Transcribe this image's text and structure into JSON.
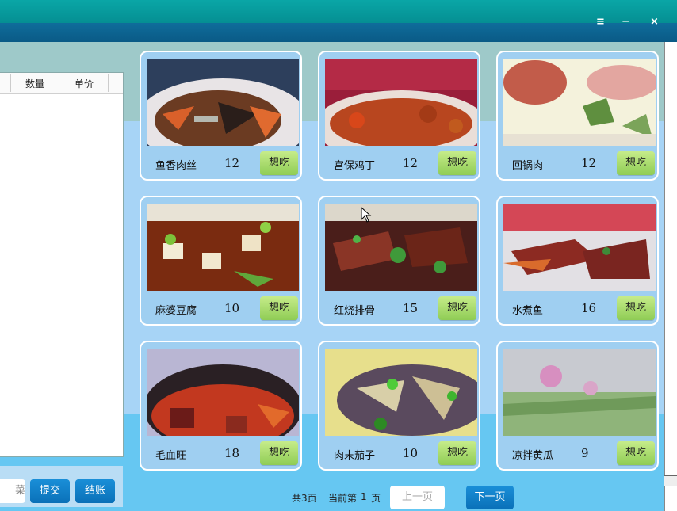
{
  "window": {
    "controls": {
      "menu": "≡",
      "minimize": "−",
      "close": "×"
    }
  },
  "order": {
    "columns": [
      "数量",
      "单价"
    ],
    "partial_button": "菜",
    "submit_label": "提交",
    "checkout_label": "结账"
  },
  "dishes": [
    {
      "name": "鱼香肉丝",
      "price": "12",
      "button": "想吃"
    },
    {
      "name": "宫保鸡丁",
      "price": "12",
      "button": "想吃"
    },
    {
      "name": "回锅肉",
      "price": "12",
      "button": "想吃"
    },
    {
      "name": "麻婆豆腐",
      "price": "10",
      "button": "想吃"
    },
    {
      "name": "红烧排骨",
      "price": "15",
      "button": "想吃"
    },
    {
      "name": "水煮鱼",
      "price": "16",
      "button": "想吃"
    },
    {
      "name": "毛血旺",
      "price": "18",
      "button": "想吃"
    },
    {
      "name": "肉末茄子",
      "price": "10",
      "button": "想吃"
    },
    {
      "name": "凉拌黄瓜",
      "price": "9",
      "button": "想吃"
    }
  ],
  "pagination": {
    "total_label": "共3页",
    "current_label": "当前第",
    "current_page": "1",
    "page_unit": "页",
    "prev_label": "上一页",
    "next_label": "下一页"
  },
  "colors": {
    "accent_blue": "#0a70b8",
    "want_green": "#9fd460",
    "title_teal": "#058f93"
  }
}
